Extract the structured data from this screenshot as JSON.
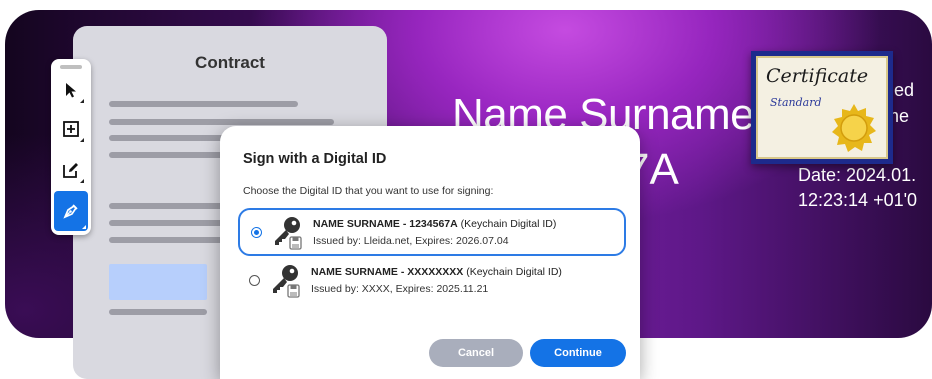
{
  "banner": {
    "name": "Name Surname",
    "id_fragment": "7A",
    "side_lines": [
      "gned",
      "ame",
      "Date: 2024.01.",
      "12:23:14 +01'0"
    ]
  },
  "document": {
    "title": "Contract"
  },
  "toolbar": {
    "tools": [
      "select-tool",
      "add-text-tool",
      "edit-tool",
      "sign-tool"
    ],
    "active": "sign-tool"
  },
  "certificate": {
    "title": "Certificate",
    "subtitle": "Standard"
  },
  "dialog": {
    "title": "Sign with a Digital ID",
    "description": "Choose the Digital ID that you want to use for signing:",
    "options": [
      {
        "name": "NAME SURNAME - 1234567A",
        "type": "(Keychain Digital ID)",
        "details": "Issued  by: Lleida.net, Expires: 2026.07.04",
        "selected": true
      },
      {
        "name": "NAME SURNAME - XXXXXXXX",
        "type": "(Keychain Digital ID)",
        "details": "Issued  by: XXXX, Expires: 2025.11.21",
        "selected": false
      }
    ],
    "cancel_label": "Cancel",
    "continue_label": "Continue"
  },
  "colors": {
    "accent": "#1473e6",
    "cancel": "#a9aebc",
    "document": "#d9d9e0",
    "highlight_box": "#b7cffc"
  }
}
